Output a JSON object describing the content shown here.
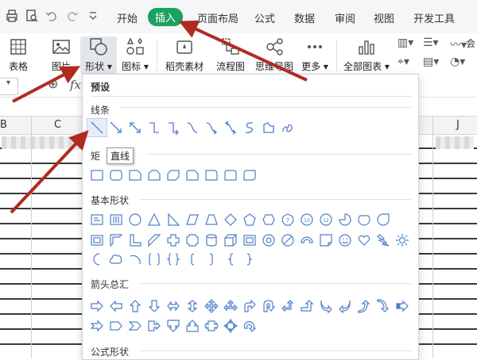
{
  "tabs": [
    "开始",
    "插入",
    "页面布局",
    "公式",
    "数据",
    "审阅",
    "视图",
    "开发工具"
  ],
  "ribbon": {
    "table": "表格",
    "picture": "图片",
    "shapes": "形状",
    "icons": "图标",
    "docer": "稻壳素材",
    "flowchart": "流程图",
    "mindmap": "思维导图",
    "more": "更多",
    "all_charts": "全部图表",
    "extra_labels": [
      "会",
      "0"
    ]
  },
  "formula_bar": {
    "fx": "fx"
  },
  "columns": [
    "B",
    "C",
    "J"
  ],
  "shapes_panel": {
    "preset": "预设",
    "sections": {
      "lines": "线条",
      "rect": "矩",
      "basic": "基本形状",
      "arrows": "箭头总汇",
      "equation": "公式形状"
    },
    "tooltip": "直线"
  },
  "colors": {
    "active_tab": "#1aa260",
    "shape_stroke": "#4f7fc7",
    "annotation_arrow": "#b02a20"
  }
}
